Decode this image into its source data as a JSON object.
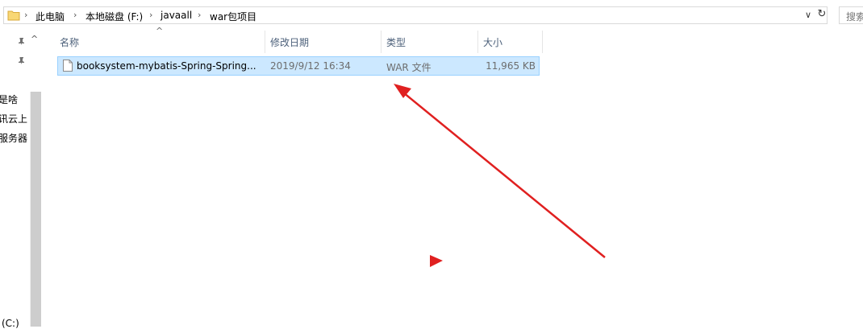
{
  "address_bar": {
    "breadcrumbs": [
      "此电脑",
      "本地磁盘 (F:)",
      "javaall",
      "war包项目"
    ],
    "search_placeholder": "搜索"
  },
  "nav": {
    "items": [
      "是啥",
      "讯云上",
      "服务器",
      "(C:)"
    ]
  },
  "columns": {
    "name": "名称",
    "date": "修改日期",
    "type": "类型",
    "size": "大小"
  },
  "files": [
    {
      "name": "booksystem-mybatis-Spring-Spring...",
      "date": "2019/9/12 16:34",
      "type": "WAR 文件",
      "size": "11,965 KB"
    }
  ],
  "colors": {
    "selection_fill": "#cce8ff",
    "selection_border": "#99d1ff",
    "annotation_red": "#e02020",
    "folder_yellow": "#f8d775"
  },
  "icons": {
    "folder": "folder-icon",
    "file": "file-icon",
    "pin": "pin-icon",
    "refresh": "refresh-icon",
    "chevron": "chevron-down-icon"
  }
}
